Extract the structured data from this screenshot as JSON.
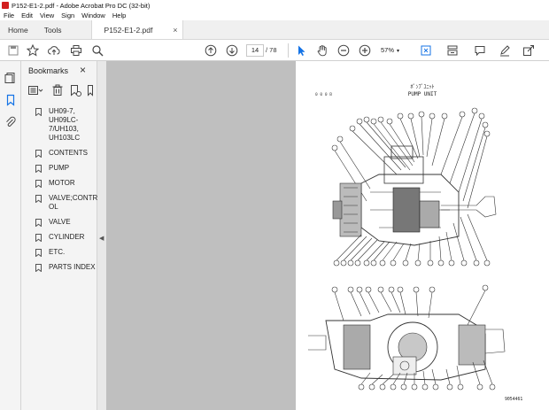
{
  "window": {
    "title": "P152-E1-2.pdf - Adobe Acrobat Pro DC (32-bit)"
  },
  "menu": [
    "File",
    "Edit",
    "View",
    "Sign",
    "Window",
    "Help"
  ],
  "tabs": {
    "home": "Home",
    "tools": "Tools",
    "document": "P152-E1-2.pdf",
    "close_glyph": "×"
  },
  "toolbar": {
    "current_page": "14",
    "page_total": "/ 78",
    "zoom": "57%"
  },
  "bookmarks": {
    "title": "Bookmarks",
    "close_glyph": "×",
    "items": [
      "UH09-7, UH09LC-7/UH103, UH103LC",
      "CONTENTS",
      "PUMP",
      "MOTOR",
      "VALVE;CONTROL",
      "VALVE",
      "CYLINDER",
      "ETC.",
      "PARTS INDEX"
    ]
  },
  "page_content": {
    "header_jp": "ﾎﾟﾝﾌﾟﾕﾆｯﾄ",
    "header_en": "PUMP UNIT",
    "code": "0 0 0 B",
    "figure_ref": "9054461"
  },
  "colors": {
    "doc_background": "#bfbfbf",
    "accent_blue": "#1473e6",
    "app_red": "#d21f1f"
  },
  "icons": {
    "save": "save-icon",
    "bookmark_add": "bookmark-star-icon",
    "upload": "cloud-upload-icon",
    "print": "print-icon",
    "search": "search-icon",
    "page_up": "arrow-up-circle-icon",
    "page_down": "arrow-down-circle-icon",
    "select": "cursor-arrow-icon",
    "hand": "hand-icon",
    "zoom_out": "zoom-out-icon",
    "zoom_in": "zoom-in-icon",
    "fit": "fit-page-icon",
    "scroll_mode": "scroll-mode-icon",
    "comment": "comment-icon",
    "sign": "pen-icon",
    "share": "share-icon"
  }
}
